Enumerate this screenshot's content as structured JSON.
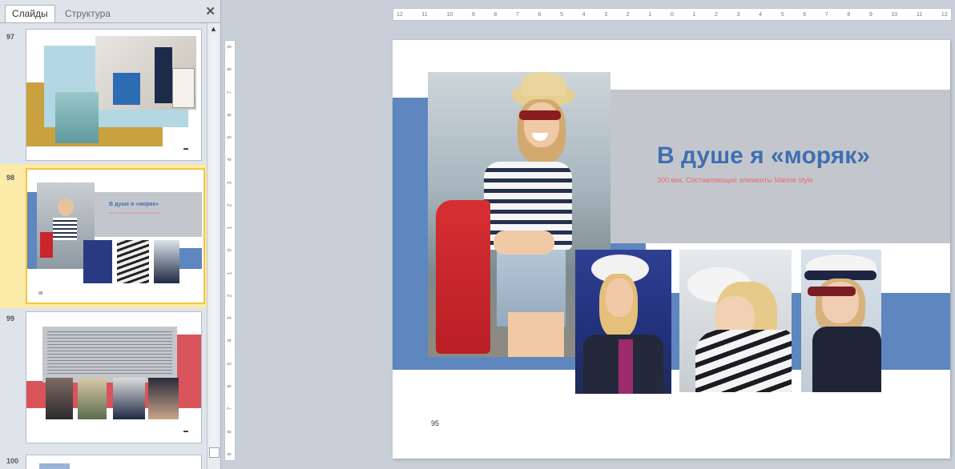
{
  "tabs": {
    "slides": "Слайды",
    "outline": "Структура",
    "close": "✕"
  },
  "thumbnails": [
    {
      "number": "97"
    },
    {
      "number": "98",
      "title": "В душе я «моряк»",
      "subtitle": "300 век. Составляющие элементы Marine style"
    },
    {
      "number": "99"
    },
    {
      "number": "100"
    }
  ],
  "ruler": {
    "horizontal": [
      "12",
      "11",
      "10",
      "9",
      "8",
      "7",
      "6",
      "5",
      "4",
      "3",
      "2",
      "1",
      "0",
      "1",
      "2",
      "3",
      "4",
      "5",
      "6",
      "7",
      "8",
      "9",
      "10",
      "11",
      "12"
    ],
    "vertical": [
      "9",
      "8",
      "7",
      "6",
      "5",
      "4",
      "3",
      "2",
      "1",
      "0",
      "1",
      "2",
      "3",
      "4",
      "5",
      "6",
      "7",
      "8",
      "9"
    ]
  },
  "slide": {
    "title": "В душе я «моряк»",
    "subtitle": "300 век. Составляющие элементы Marine style",
    "page_number": "95"
  },
  "colors": {
    "accent_blue": "#5e86bf",
    "title_blue": "#3f6fb0",
    "band_gray": "#c3c7cd",
    "subtitle_red": "#e86b6b",
    "selected_thumb": "#f4c542"
  }
}
